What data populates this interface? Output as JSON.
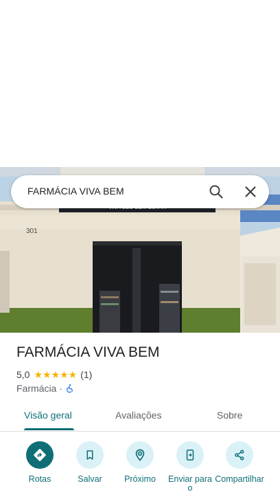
{
  "search": {
    "query": "FARMÁCIA VIVA BEM"
  },
  "photo": {
    "sign_text": "VIVA SEU BEM ESTAR",
    "house_number": "301"
  },
  "place": {
    "name": "FARMÁCIA VIVA BEM",
    "rating": "5,0",
    "stars": "★★★★★",
    "review_count": "(1)",
    "category": "Farmácia",
    "separator": "·"
  },
  "tabs": [
    {
      "label": "Visão geral",
      "active": true
    },
    {
      "label": "Avaliações",
      "active": false
    },
    {
      "label": "Sobre",
      "active": false
    }
  ],
  "actions": [
    {
      "label": "Rotas",
      "icon": "directions-icon"
    },
    {
      "label": "Salvar",
      "icon": "bookmark-icon"
    },
    {
      "label": "Próximo",
      "icon": "nearby-icon"
    },
    {
      "label": "Enviar para o",
      "icon": "send-to-phone-icon"
    },
    {
      "label": "Compartilhar",
      "icon": "share-icon"
    }
  ],
  "colors": {
    "accent": "#0f6e76",
    "action_bg": "#d9f1f7",
    "star": "#f4b400"
  }
}
